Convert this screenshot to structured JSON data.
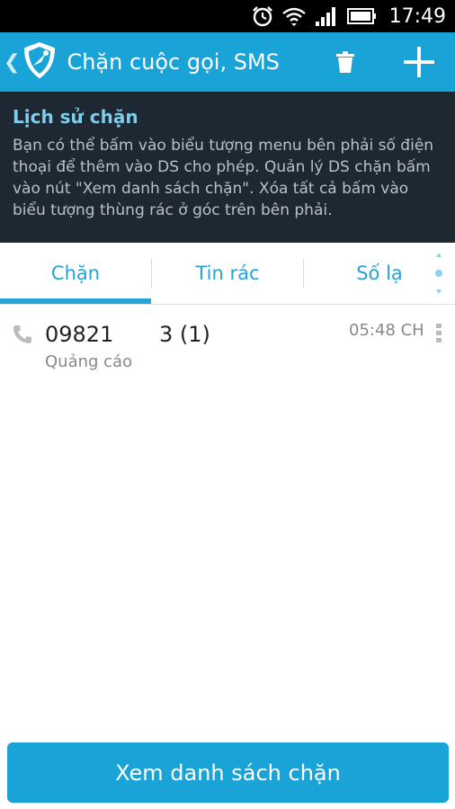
{
  "status_bar": {
    "time": "17:49",
    "icons": [
      "alarm-icon",
      "wifi-icon",
      "signal-icon",
      "battery-icon"
    ]
  },
  "app_bar": {
    "title": "Chặn cuộc gọi, SMS",
    "back_icon": "chevron-left-icon",
    "logo_icon": "shield-icon",
    "actions": [
      "trash-icon",
      "plus-icon"
    ],
    "color": "#1aa3d6"
  },
  "info": {
    "title": "Lịch sử chặn",
    "lines": [
      "Bạn có thể bấm vào biểu tượng menu bên phải số điện",
      "thoại để thêm vào DS cho phép. Quản lý DS chặn bấm",
      "vào nút \"Xem danh sách chặn\". Xóa tất cả bấm vào",
      "biểu tượng thùng rác ở góc trên bên phải."
    ]
  },
  "tabs": [
    {
      "label": "Chặn",
      "selected": true
    },
    {
      "label": "Tin rác",
      "selected": false
    },
    {
      "label": "Số lạ",
      "selected": false
    }
  ],
  "blocked_calls": [
    {
      "number": "09821",
      "count": "3 (1)",
      "label": "Quảng cáo",
      "time": "05:48 CH"
    }
  ],
  "bottom_button": {
    "label": "Xem danh sách chặn"
  }
}
